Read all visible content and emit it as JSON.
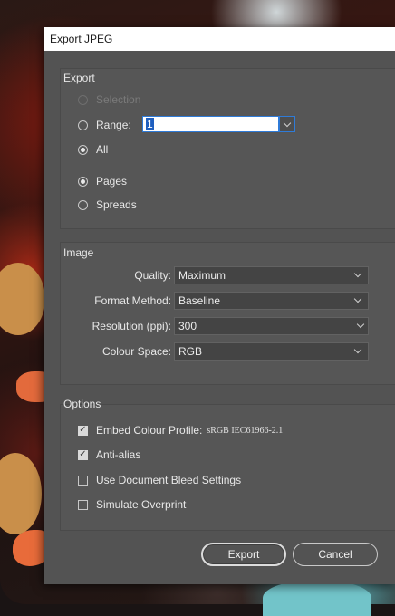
{
  "window": {
    "title": "Export JPEG"
  },
  "export_group": {
    "title": "Export",
    "selection_label": "Selection",
    "range_label": "Range:",
    "range_value": "1",
    "all_label": "All",
    "pages_label": "Pages",
    "spreads_label": "Spreads",
    "selected_scope": "All",
    "selected_layout": "Pages"
  },
  "image_group": {
    "title": "Image",
    "quality_label": "Quality:",
    "quality_value": "Maximum",
    "format_label": "Format Method:",
    "format_value": "Baseline",
    "resolution_label": "Resolution (ppi):",
    "resolution_value": "300",
    "colour_space_label": "Colour Space:",
    "colour_space_value": "RGB"
  },
  "options_group": {
    "title": "Options",
    "embed_profile_label": "Embed Colour Profile:",
    "embed_profile_value": "sRGB IEC61966-2.1",
    "embed_profile_checked": true,
    "anti_alias_label": "Anti-alias",
    "anti_alias_checked": true,
    "bleed_label": "Use Document Bleed Settings",
    "bleed_checked": false,
    "overprint_label": "Simulate Overprint",
    "overprint_checked": false
  },
  "buttons": {
    "export_label": "Export",
    "cancel_label": "Cancel"
  },
  "colors": {
    "dialog_bg": "#535353",
    "accent_blue": "#2f7bd8",
    "titlebar_bg": "#ffffff"
  }
}
